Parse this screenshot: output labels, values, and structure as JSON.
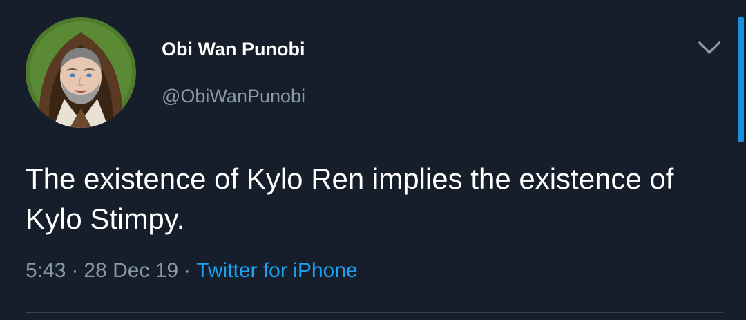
{
  "colors": {
    "background": "#151e2a",
    "text": "#ffffff",
    "muted": "#8899a6",
    "accent": "#1da1f2",
    "divider": "#38444d"
  },
  "author": {
    "display_name": "Obi Wan Punobi",
    "handle": "@ObiWanPunobi",
    "avatar_icon": "profile-avatar"
  },
  "tweet": {
    "text": "The existence of Kylo Ren implies the existence of Kylo Stimpy."
  },
  "meta": {
    "time": "5:43",
    "separator": "·",
    "date": "28 Dec 19",
    "source": "Twitter for iPhone"
  },
  "icons": {
    "menu": "chevron-down-icon"
  }
}
